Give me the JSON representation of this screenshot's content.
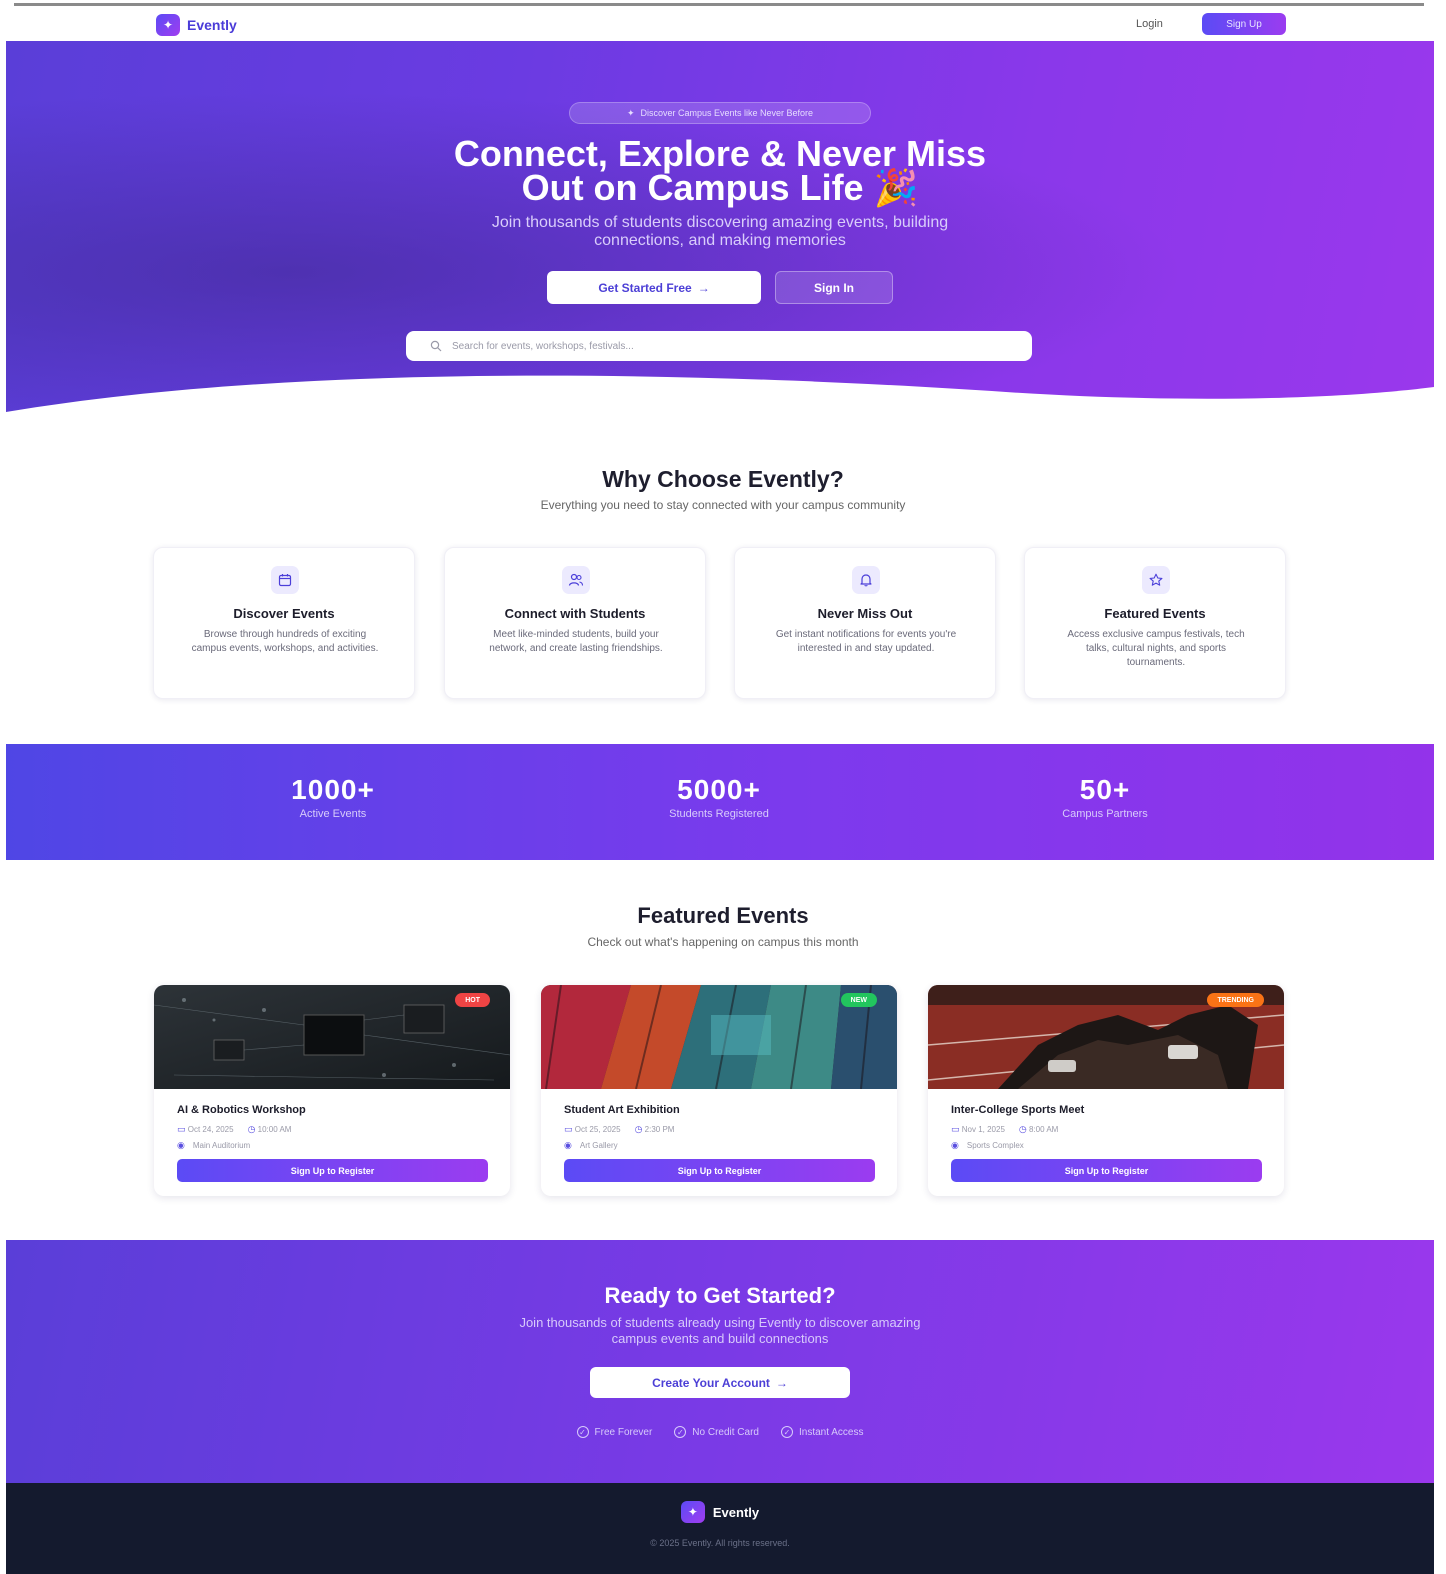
{
  "nav": {
    "brand": "Evently",
    "login": "Login",
    "signup": "Sign Up"
  },
  "hero": {
    "pill": "Discover Campus Events like Never Before",
    "title_line1": "Connect, Explore & Never Miss",
    "title_line2": "Out on Campus Life",
    "title_emoji": "🎉",
    "subtitle_line1": "Join thousands of students discovering amazing events, building",
    "subtitle_line2": "connections, and making memories",
    "cta_primary": "Get Started Free",
    "cta_secondary": "Sign In",
    "search_placeholder": "Search for events, workshops, festivals..."
  },
  "why": {
    "title": "Why Choose Evently?",
    "subtitle": "Everything you need to stay connected with your campus community",
    "features": [
      {
        "icon": "calendar-icon",
        "title": "Discover Events",
        "desc": "Browse through hundreds of exciting campus events, workshops, and activities."
      },
      {
        "icon": "users-icon",
        "title": "Connect with Students",
        "desc": "Meet like-minded students, build your network, and create lasting friendships."
      },
      {
        "icon": "bell-icon",
        "title": "Never Miss Out",
        "desc": "Get instant notifications for events you're interested in and stay updated."
      },
      {
        "icon": "star-icon",
        "title": "Featured Events",
        "desc": "Access exclusive campus festivals, tech talks, cultural nights, and sports tournaments."
      }
    ]
  },
  "stats": [
    {
      "value": "1000+",
      "label": "Active Events"
    },
    {
      "value": "5000+",
      "label": "Students Registered"
    },
    {
      "value": "50+",
      "label": "Campus Partners"
    }
  ],
  "featured": {
    "title": "Featured Events",
    "subtitle": "Check out what's happening on campus this month",
    "events": [
      {
        "badge": "HOT",
        "badge_color": "#ef4444",
        "title": "AI & Robotics Workshop",
        "date": "Oct 24, 2025",
        "time": "10:00 AM",
        "location": "Main Auditorium",
        "button": "Sign Up to Register"
      },
      {
        "badge": "NEW",
        "badge_color": "#22c55e",
        "title": "Student Art Exhibition",
        "date": "Oct 25, 2025",
        "time": "2:30 PM",
        "location": "Art Gallery",
        "button": "Sign Up to Register"
      },
      {
        "badge": "TRENDING",
        "badge_color": "#f97316",
        "title": "Inter-College Sports Meet",
        "date": "Nov 1, 2025",
        "time": "8:00 AM",
        "location": "Sports Complex",
        "button": "Sign Up to Register"
      }
    ]
  },
  "cta": {
    "title": "Ready to Get Started?",
    "subtitle_line1": "Join thousands of students already using Evently to discover amazing",
    "subtitle_line2": "campus events and build connections",
    "button": "Create Your Account",
    "perks": [
      "Free Forever",
      "No Credit Card",
      "Instant Access"
    ]
  },
  "footer": {
    "brand": "Evently",
    "copyright": "© 2025 Evently. All rights reserved."
  },
  "colors": {
    "primary": "#5b4bf5",
    "accent": "#9333ea",
    "footer_bg": "#141a2e"
  }
}
